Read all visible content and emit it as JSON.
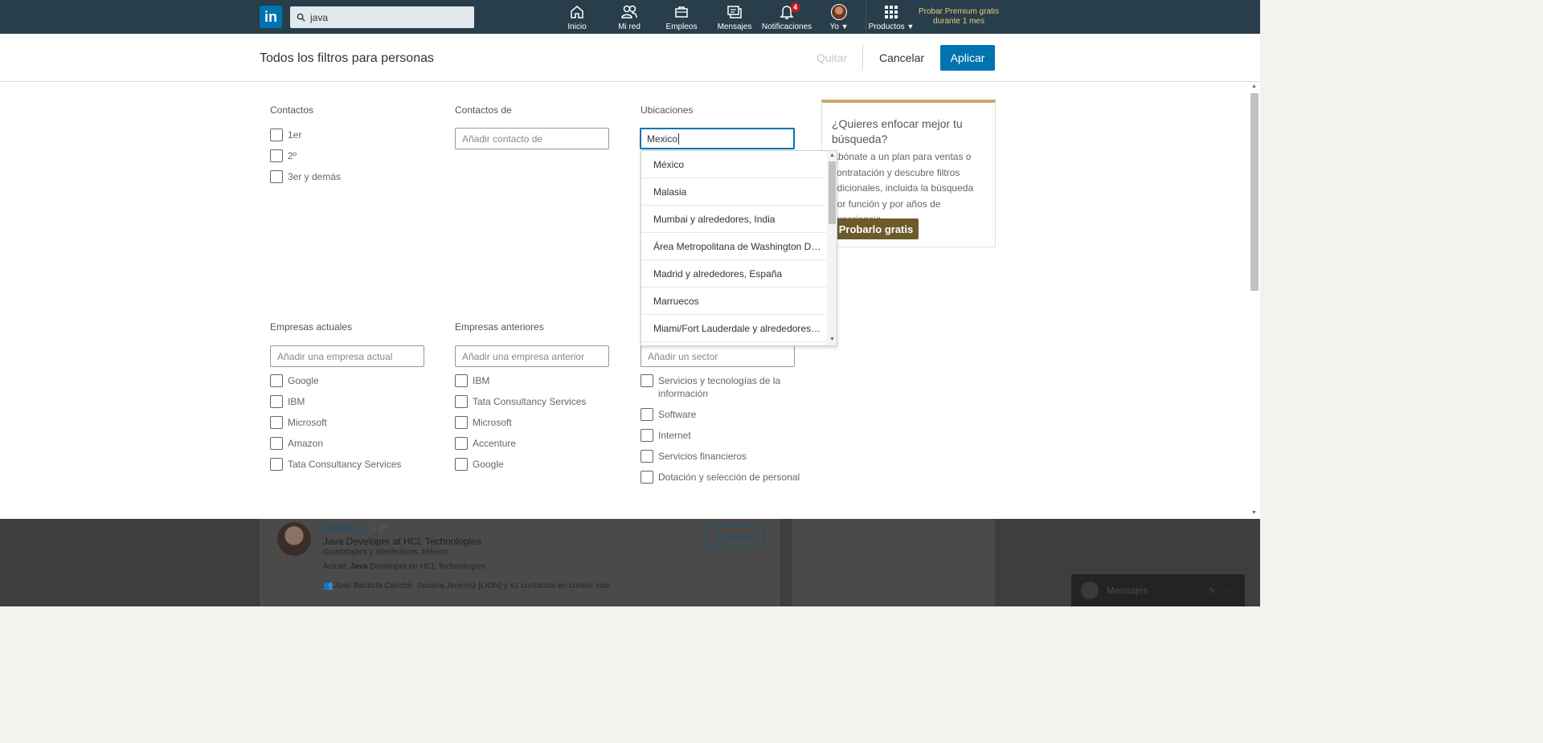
{
  "topbar": {
    "logo_text": "in",
    "search_query": "java",
    "nav": [
      {
        "label": "Inicio",
        "icon": "home-icon"
      },
      {
        "label": "Mi red",
        "icon": "network-icon"
      },
      {
        "label": "Empleos",
        "icon": "briefcase-icon"
      },
      {
        "label": "Mensajes",
        "icon": "messaging-icon"
      },
      {
        "label": "Notificaciones",
        "icon": "bell-icon",
        "badge": "4"
      },
      {
        "label": "Yo",
        "icon": "avatar"
      },
      {
        "label": "Productos",
        "icon": "grid-icon"
      }
    ],
    "premium_line1": "Probar Premium gratis",
    "premium_line2": "durante 1 mes"
  },
  "filter_header": {
    "title": "Todos los filtros para personas",
    "remove_label": "Quitar",
    "cancel_label": "Cancelar",
    "apply_label": "Aplicar"
  },
  "connections": {
    "label": "Contactos",
    "options": [
      "1er",
      "2º",
      "3er y demás"
    ]
  },
  "connections_of": {
    "label": "Contactos de",
    "placeholder": "Añadir contacto de"
  },
  "locations": {
    "label": "Ubicaciones",
    "value": "Mexico",
    "suggestions": [
      "México",
      "Malasia",
      "Mumbai y alrededores, India",
      "Área Metropolitana de Washington D.C.",
      "Madrid y alrededores, España",
      "Marruecos",
      "Miami/Fort Lauderdale y alrededores, Estados Unidos"
    ]
  },
  "current_companies": {
    "label": "Empresas actuales",
    "placeholder": "Añadir una empresa actual",
    "options": [
      "Google",
      "IBM",
      "Microsoft",
      "Amazon",
      "Tata Consultancy Services"
    ]
  },
  "past_companies": {
    "label": "Empresas anteriores",
    "placeholder": "Añadir una empresa anterior",
    "options": [
      "IBM",
      "Tata Consultancy Services",
      "Microsoft",
      "Accenture",
      "Google"
    ]
  },
  "industries": {
    "placeholder": "Añadir un sector",
    "options": [
      "Servicios y tecnologías de la información",
      "Software",
      "Internet",
      "Servicios financieros",
      "Dotación y selección de personal"
    ]
  },
  "promo": {
    "title": "¿Quieres enfocar mejor tu búsqueda?",
    "body": "Abónate a un plan para ventas o contratación y descubre filtros adicionales, incluida la búsqueda por función y por años de experiencia.",
    "button": "Probarlo gratis"
  },
  "background_result": {
    "name": "Abilene F.",
    "degree": " • 2º",
    "headline": "Java Developer at HCL Technologies",
    "location": "Guadalajara y alrededores, México",
    "current_prefix": "Actual: ",
    "current_keyword": "Java",
    "current_rest": " Developer en HCL Technologies",
    "shared": "Anel Bautista Canché, Susana Jimenez [LION] y 61 contactos en común más",
    "connect_label": "Conectar"
  },
  "messaging": {
    "label": "Mensajes"
  }
}
